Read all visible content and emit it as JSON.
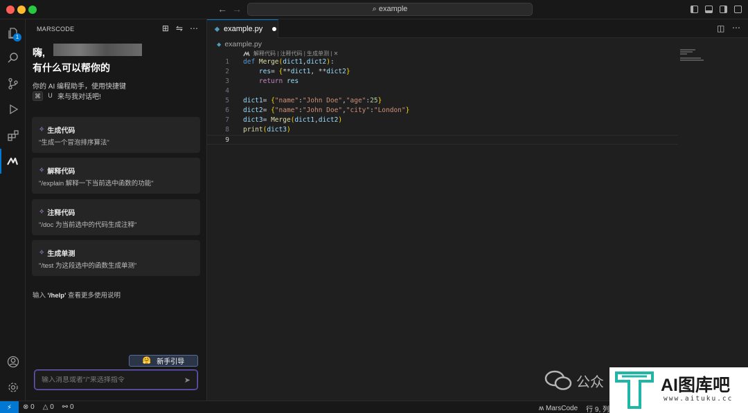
{
  "titlebar": {
    "search": "example"
  },
  "activity_badge": "1",
  "sidebar": {
    "title": "MARSCODE",
    "greeting": "嗨,",
    "greeting2": "有什么可以帮你的",
    "intro": "你的 AI 编程助手，使用快捷键",
    "shortcut_key1": "⌘",
    "shortcut_key2": "U",
    "intro_suffix": "来与我对话吧!",
    "cards": [
      {
        "title": "生成代码",
        "desc": "\"生成一个冒泡排序算法\""
      },
      {
        "title": "解释代码",
        "desc": "\"/explain 解释一下当前选中函数的功能\""
      },
      {
        "title": "注释代码",
        "desc": "\"/doc 为当前选中的代码生成注释\""
      },
      {
        "title": "生成单测",
        "desc": "\"/test 为这段选中的函数生成单测\""
      }
    ],
    "help_prefix": "输入",
    "help_cmd": "'/help'",
    "help_suffix": "查看更多使用说明",
    "guide_button": "新手引导",
    "chat_placeholder": "输入消息或者\"/\"来选择指令"
  },
  "editor": {
    "tab_label": "example.py",
    "breadcrumb": "example.py",
    "codelens": "解释代码 | 注释代码 | 生成单测 | ✕",
    "line_numbers": [
      "1",
      "2",
      "3",
      "4",
      "5",
      "6",
      "7",
      "8",
      "9"
    ]
  },
  "statusbar": {
    "errors": "0",
    "warnings": "0",
    "ports": "0",
    "marscode": "MarsCode",
    "position": "行 9, 列"
  },
  "watermark": {
    "wechat": "公众",
    "brand": "AI图库吧",
    "url": "www.aituku.cc"
  },
  "colors": {
    "accent": "#0078d4",
    "keyword": "#c586c0",
    "function": "#dcdcaa",
    "string": "#ce9178",
    "number": "#b5cea8"
  }
}
